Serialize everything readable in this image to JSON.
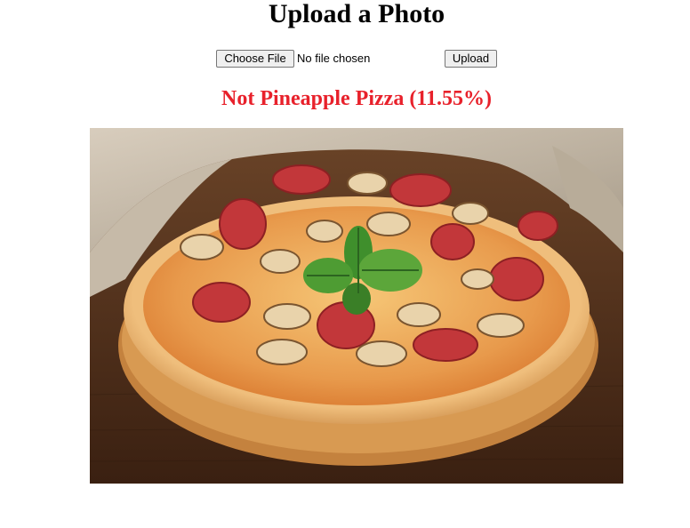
{
  "page": {
    "title": "Upload a Photo"
  },
  "form": {
    "choose_file_label": "Choose File",
    "file_status": "No file chosen",
    "upload_label": "Upload"
  },
  "result": {
    "text": "Not Pineapple Pizza (11.55%)",
    "color": "#e8212b"
  },
  "photo": {
    "subject": "pizza-photo"
  }
}
